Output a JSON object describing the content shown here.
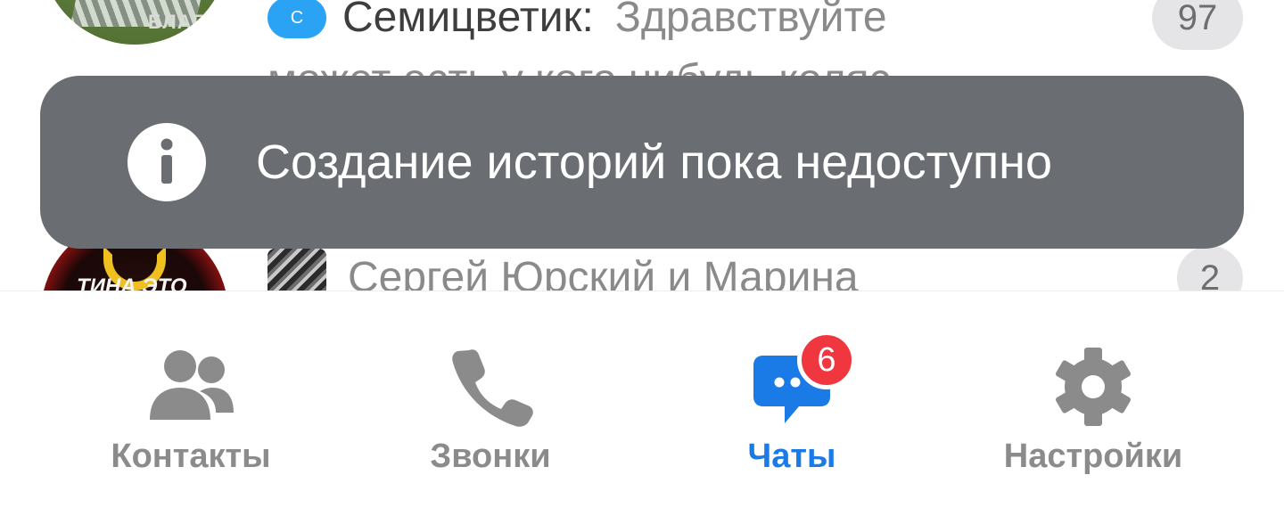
{
  "chats": [
    {
      "chip": "С",
      "sender": "Семицветик:",
      "preview": "Здравствуйте",
      "preview_line2": "может есть у кого нибудь коляс",
      "unread": "97",
      "avatar_caption": "БЛАГ"
    },
    {
      "sender": "Сергей Юрский и Марина",
      "unread": "2",
      "avatar_caption": "ТИНА ЭТО"
    }
  ],
  "toast": {
    "icon": "info-icon",
    "message": "Создание историй пока недоступно"
  },
  "tabbar": {
    "tabs": [
      {
        "label": "Контакты",
        "icon": "contacts-icon",
        "active": false
      },
      {
        "label": "Звонки",
        "icon": "phone-icon",
        "active": false
      },
      {
        "label": "Чаты",
        "icon": "chat-icon",
        "active": true,
        "badge": "6"
      },
      {
        "label": "Настройки",
        "icon": "gear-icon",
        "active": false
      }
    ]
  },
  "colors": {
    "accent": "#1b7be6",
    "badge_red": "#f03740",
    "toast_bg": "#6a6d72",
    "inactive": "#8b8b8b",
    "chip_blue": "#2aa3f5"
  }
}
